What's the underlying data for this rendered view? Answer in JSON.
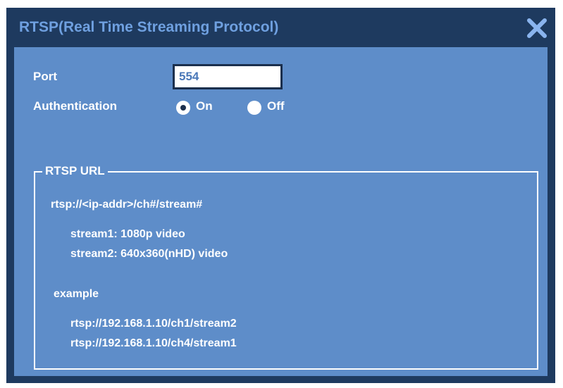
{
  "window": {
    "title": "RTSP(Real Time Streaming Protocol)",
    "close_icon": "close-icon"
  },
  "form": {
    "port_label": "Port",
    "port_value": "554",
    "auth_label": "Authentication",
    "auth_options": [
      {
        "label": "On",
        "selected": true
      },
      {
        "label": "Off",
        "selected": false
      }
    ]
  },
  "rtsp_url": {
    "legend": "RTSP URL",
    "format": "rtsp://<ip-addr>/ch#/stream#",
    "streams": [
      "stream1:  1080p video",
      "stream2:  640x360(nHD) video"
    ],
    "example_label": "example",
    "examples": [
      "rtsp://192.168.1.10/ch1/stream2",
      "rtsp://192.168.1.10/ch4/stream1"
    ]
  },
  "colors": {
    "titlebar": "#1e3a5f",
    "body": "#5e8dc9",
    "title_text": "#6fa0e0"
  }
}
